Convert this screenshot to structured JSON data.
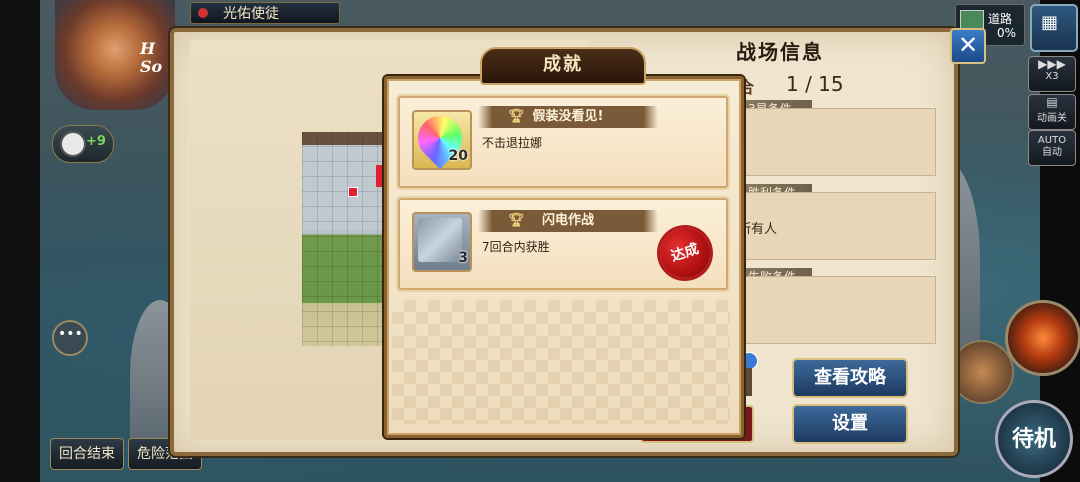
{
  "unit_name": "光佑使徒",
  "character_tag": "H\nSo",
  "clock_bonus": "+9",
  "road": {
    "label": "道路",
    "value": "0%"
  },
  "side_buttons": [
    {
      "icon": "fast-forward-icon",
      "label": "X3"
    },
    {
      "icon": "film-icon",
      "label": "动画关"
    },
    {
      "icon": "auto-icon",
      "label": "AUTO\n自动"
    }
  ],
  "bottom_buttons": {
    "end_turn": "回合结束",
    "danger_zone": "危险范围"
  },
  "standby_label": "待机",
  "battlefield_info": {
    "title": "战场信息",
    "turn_label": "合",
    "turn_value": "1 / 15",
    "conditions": [
      {
        "header": "3星条件",
        "text": ""
      },
      {
        "header": "胜利条件",
        "text": "所有人"
      },
      {
        "header": "失败条件",
        "text": ""
      }
    ],
    "strategy_button": "查看攻略",
    "settings_button": "设置",
    "close_label": "✕"
  },
  "achievements": {
    "title": "成就",
    "items": [
      {
        "name": "假装没看见!",
        "desc": "不击退拉娜",
        "reward_count": "20",
        "reward_icon": "rainbow-gem-icon",
        "achieved": false
      },
      {
        "name": "闪电作战",
        "desc": "7回合内获胜",
        "reward_count": "3",
        "reward_icon": "silver-ticket-icon",
        "achieved": true,
        "achieved_label": "达成"
      }
    ]
  }
}
